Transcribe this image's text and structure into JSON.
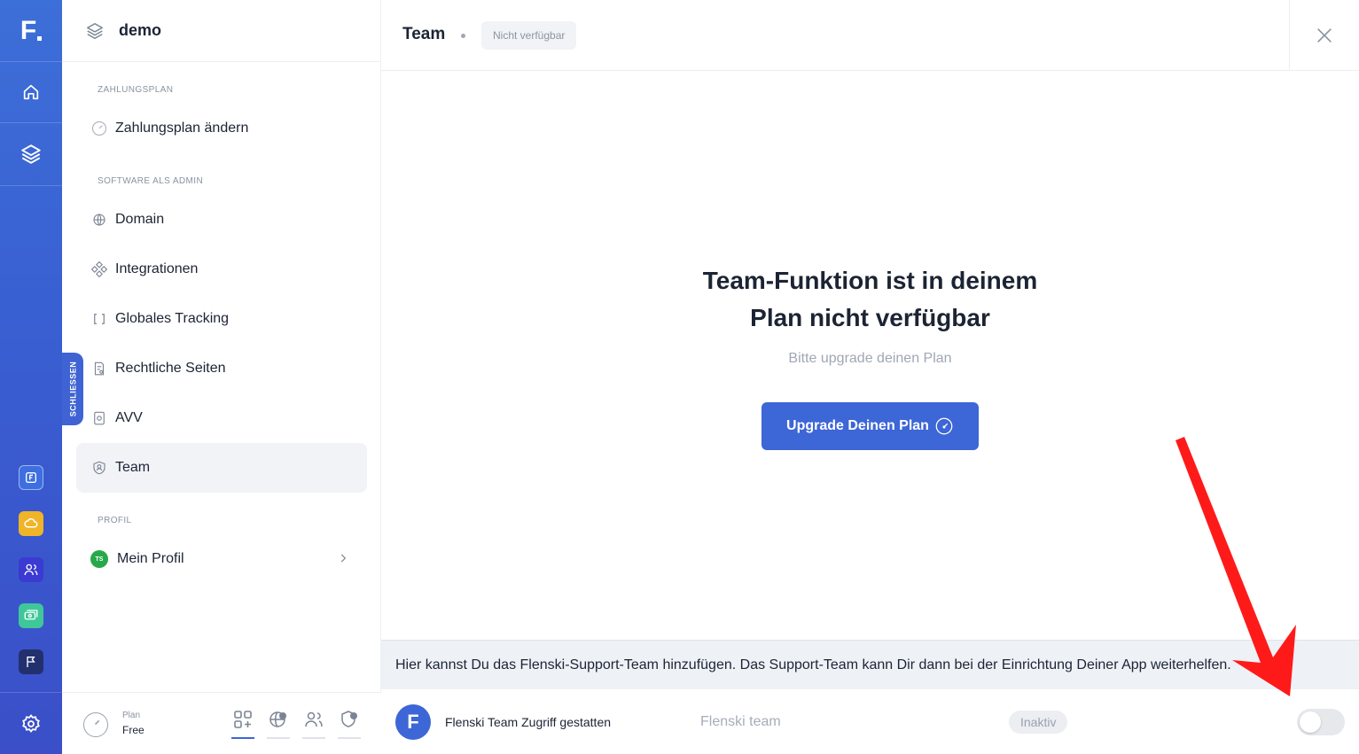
{
  "rail": {
    "logo_letter": "F",
    "nav_icons": [
      "home-icon",
      "layers-icon"
    ],
    "apps": [
      {
        "name": "flenski-app-icon",
        "color": "#3d6fe0"
      },
      {
        "name": "cloud-app-icon",
        "color": "#f0b428"
      },
      {
        "name": "users-app-icon",
        "color": "#3b3ad2"
      },
      {
        "name": "money-app-icon",
        "color": "#3fc79a"
      },
      {
        "name": "flag-app-icon",
        "color": "#23306e"
      }
    ]
  },
  "sidebar": {
    "workspace": "demo",
    "collapse_label": "SCHLIESSEN",
    "sections": {
      "billing": "ZAHLUNGSPLAN",
      "admin": "SOFTWARE ALS ADMIN",
      "profile": "PROFIL"
    },
    "items": [
      {
        "label": "Zahlungsplan ändern",
        "icon": "gauge-icon"
      },
      {
        "label": "Domain",
        "icon": "globe-icon"
      },
      {
        "label": "Integrationen",
        "icon": "integrations-icon"
      },
      {
        "label": "Globales Tracking",
        "icon": "brackets-icon"
      },
      {
        "label": "Rechtliche Seiten",
        "icon": "legal-page-icon"
      },
      {
        "label": "AVV",
        "icon": "avv-icon"
      },
      {
        "label": "Team",
        "icon": "team-shield-icon",
        "active": true
      },
      {
        "label": "Mein Profil",
        "icon": "avatar"
      }
    ],
    "avatar_initials": "TS",
    "footer": {
      "plan_label": "Plan",
      "plan_value": "Free"
    }
  },
  "header": {
    "title": "Team",
    "badge": "Nicht verfügbar"
  },
  "main": {
    "heading_line1": "Team-Funktion ist in deinem",
    "heading_line2": "Plan nicht verfügbar",
    "subtitle": "Bitte upgrade deinen Plan",
    "cta_label": "Upgrade Deinen Plan"
  },
  "support": {
    "info_text": "Hier kannst Du das Flenski-Support-Team hinzufügen. Das Support-Team kann Dir dann bei der Einrichtung Deiner App weiterhelfen.",
    "logo_letter": "F",
    "access_label": "Flenski Team Zugriff gestatten",
    "name_placeholder": "Flenski team",
    "status": "Inaktiv"
  },
  "colors": {
    "accent": "#3d66d6",
    "annotation_arrow": "#ff1a1a"
  }
}
